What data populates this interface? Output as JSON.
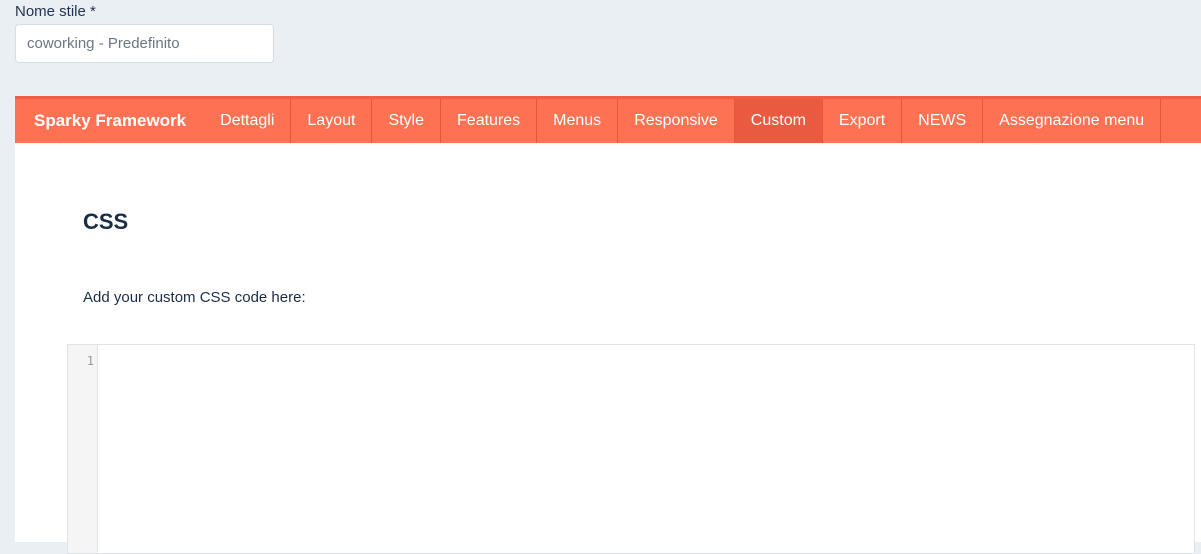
{
  "style_name": {
    "label": "Nome stile *",
    "placeholder": "coworking - Predefinito"
  },
  "tabbar": {
    "brand": "Sparky Framework",
    "tabs": [
      {
        "label": "Dettagli"
      },
      {
        "label": "Layout"
      },
      {
        "label": "Style"
      },
      {
        "label": "Features"
      },
      {
        "label": "Menus"
      },
      {
        "label": "Responsive"
      },
      {
        "label": "Custom"
      },
      {
        "label": "Export"
      },
      {
        "label": "NEWS"
      },
      {
        "label": "Assegnazione menu"
      }
    ],
    "active_tab": "Custom"
  },
  "custom": {
    "title": "CSS",
    "description": "Add your custom CSS code here:"
  },
  "editor": {
    "line_numbers": [
      "1"
    ]
  },
  "colors": {
    "tabbar_bg": "#fe7152",
    "active_tab_bg": "#e95a41",
    "page_bg": "#eaeff4"
  }
}
